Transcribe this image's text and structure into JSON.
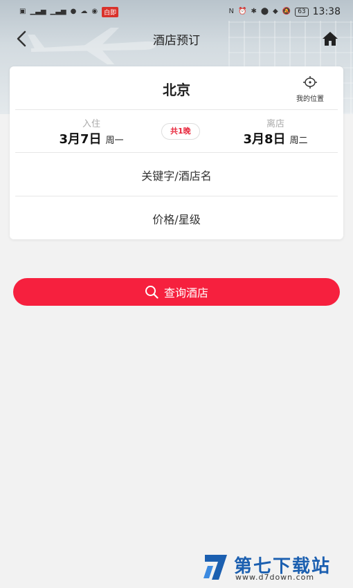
{
  "status_bar": {
    "left_icons": [
      "hd-icon",
      "signal-icon",
      "signal-icon",
      "chat-icon",
      "weather-icon",
      "wechat-icon"
    ],
    "left_badge": "白即",
    "battery": "63",
    "time": "13:38"
  },
  "navbar": {
    "title": "酒店预订"
  },
  "search_card": {
    "city": "北京",
    "locate_label": "我的位置",
    "checkin": {
      "caption": "入住",
      "date": "3月7日",
      "weekday": "周一"
    },
    "nights": "共1晚",
    "checkout": {
      "caption": "离店",
      "date": "3月8日",
      "weekday": "周二"
    },
    "keyword_placeholder": "关键字/酒店名",
    "price_placeholder": "价格/星级"
  },
  "search_button": {
    "label": "查询酒店"
  },
  "watermark": {
    "title": "第七下载站",
    "url": "www.d7down.com"
  },
  "colors": {
    "accent": "#f6203e",
    "watermark_blue": "#1b5fb0"
  }
}
